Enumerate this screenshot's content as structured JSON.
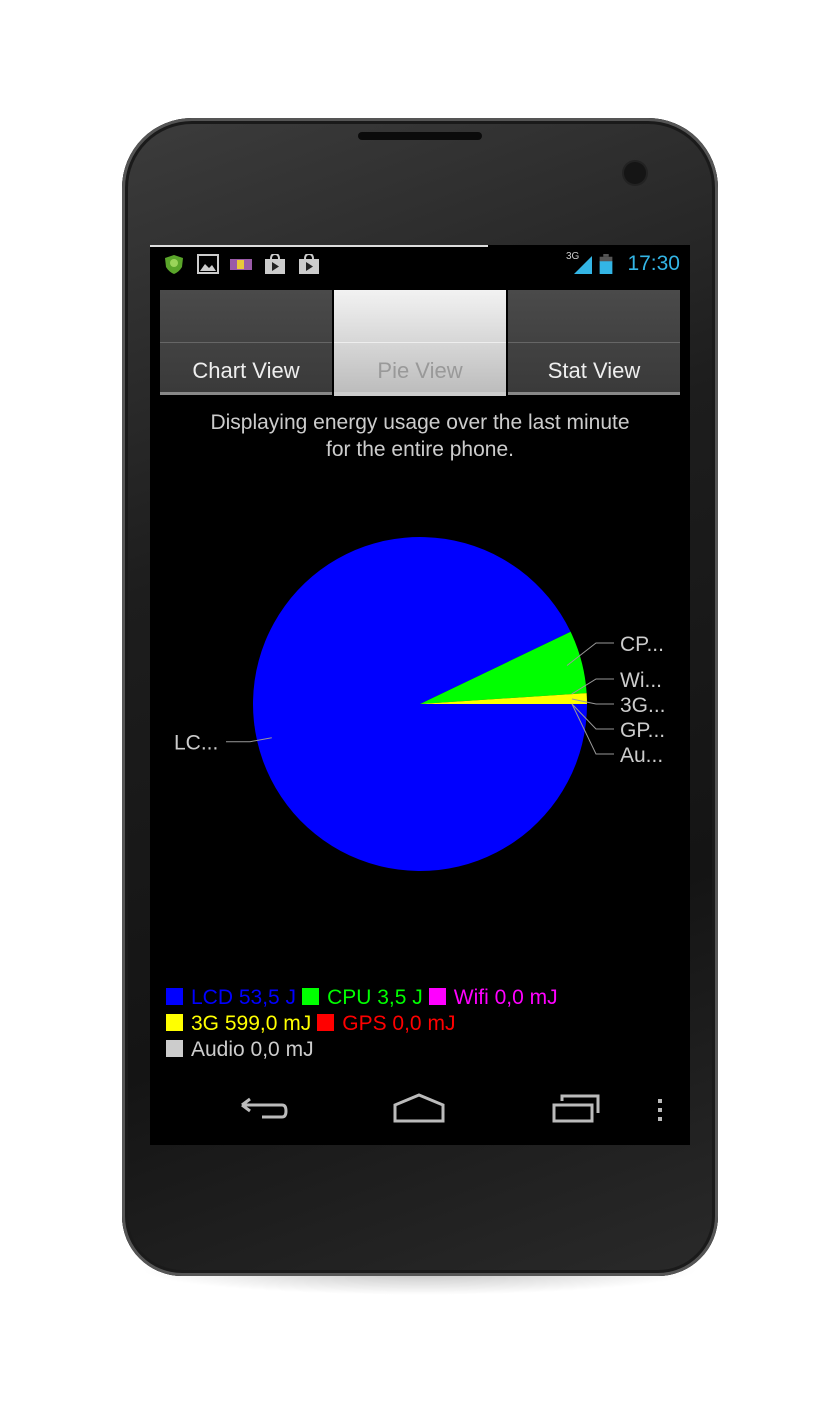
{
  "status_bar": {
    "notification_icons": [
      "shield-app-icon",
      "gallery-icon",
      "parking-app-icon",
      "play-store-icon",
      "play-store-icon"
    ],
    "network": "3G",
    "time": "17:30",
    "accent": "#33b5e5"
  },
  "tabs": [
    {
      "label": "Chart View",
      "active": false
    },
    {
      "label": "Pie View",
      "active": true
    },
    {
      "label": "Stat View",
      "active": false
    }
  ],
  "description": [
    "Displaying energy usage over the last minute",
    "for  the entire phone."
  ],
  "chart_data": {
    "type": "pie",
    "unit": "J",
    "slices": [
      {
        "name": "LCD",
        "value": 53.5,
        "short_label": "LC...",
        "legend": "LCD 53,5 J",
        "color": "#0000ff"
      },
      {
        "name": "CPU",
        "value": 3.5,
        "short_label": "CP...",
        "legend": "CPU 3,5 J",
        "color": "#00ff00"
      },
      {
        "name": "Wifi",
        "value": 0.0,
        "short_label": "Wi...",
        "legend": "Wifi 0,0 mJ",
        "color": "#ff00ff"
      },
      {
        "name": "3G",
        "value": 0.599,
        "short_label": "3G...",
        "legend": "3G 599,0 mJ",
        "color": "#ffff00"
      },
      {
        "name": "GPS",
        "value": 0.0,
        "short_label": "GP...",
        "legend": "GPS 0,0 mJ",
        "color": "#ff0000"
      },
      {
        "name": "Audio",
        "value": 0.0,
        "short_label": "Au...",
        "legend": "Audio 0,0 mJ",
        "color": "#cccccc"
      }
    ],
    "legend_position": "bottom"
  },
  "nav_bar": {
    "buttons": [
      "back-icon",
      "home-icon",
      "recents-icon",
      "menu-icon"
    ]
  }
}
